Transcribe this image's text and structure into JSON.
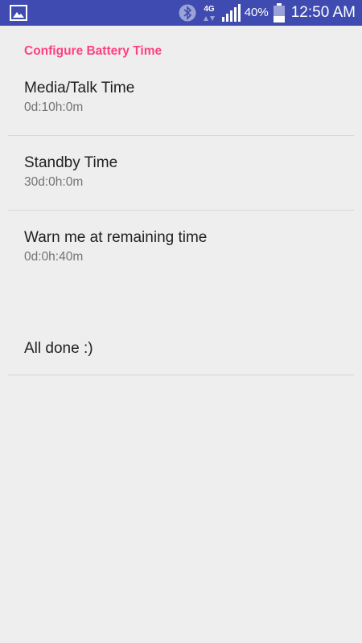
{
  "status_bar": {
    "network_label": "4G",
    "battery_percent": "40%",
    "battery_level": 0.4,
    "time": "12:50 AM",
    "icons": [
      "gallery-icon",
      "bluetooth-icon",
      "network-4g-icon",
      "signal-icon",
      "battery-icon"
    ],
    "colors": {
      "background": "#3f4bb0",
      "foreground": "#ffffff"
    }
  },
  "settings": {
    "category_title": "Configure Battery Time",
    "items": [
      {
        "title": "Media/Talk Time",
        "summary": "0d:10h:0m"
      },
      {
        "title": "Standby Time",
        "summary": "30d:0h:0m"
      },
      {
        "title": "Warn me at remaining time",
        "summary": "0d:0h:40m"
      },
      {
        "title": "All done :)"
      }
    ]
  },
  "colors": {
    "accent": "#ff4081",
    "background": "#eeeeee",
    "title_text": "#212121",
    "summary_text": "#737373",
    "divider": "#d6d6d6"
  }
}
